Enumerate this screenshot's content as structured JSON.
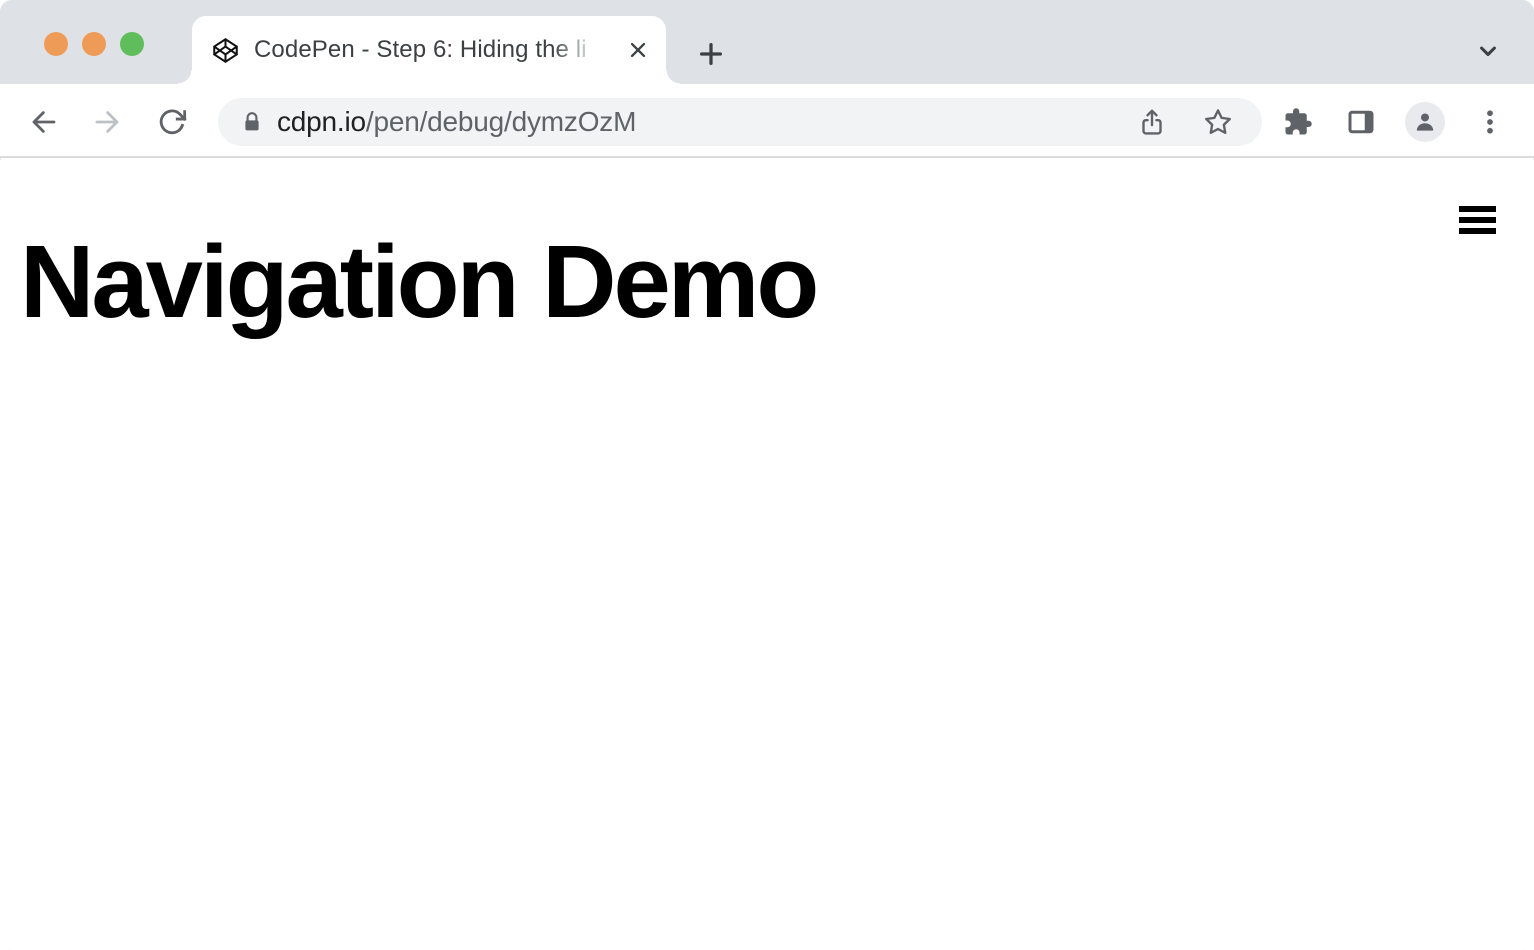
{
  "window": {
    "controls": [
      {
        "name": "close",
        "color": "#EE9B58"
      },
      {
        "name": "minimize",
        "color": "#EE9B58"
      },
      {
        "name": "maximize",
        "color": "#5FBD5B"
      }
    ]
  },
  "browser": {
    "tab": {
      "title": "CodePen - Step 6: Hiding the li"
    },
    "address_bar": {
      "domain": "cdpn.io",
      "path": "/pen/debug/dymzOzM"
    }
  },
  "page": {
    "heading": "Navigation Demo"
  },
  "icons": {
    "favicon": "codepen-logo",
    "tab_close": "x",
    "new_tab": "plus",
    "tab_strip_right": "chevron-down",
    "nav_left": [
      "arrow-left",
      "arrow-right-disabled",
      "reload"
    ],
    "omnibox": [
      "lock",
      "share",
      "bookmark-star"
    ],
    "toolbar_right": [
      "extensions-puzzle",
      "side-panel",
      "profile-avatar",
      "kebab-menu"
    ],
    "page": "hamburger-menu"
  },
  "colors": {
    "tab_strip_bg": "#DEE1E6",
    "surface": "#FFFFFF",
    "omnibox_bg": "#F1F3F4",
    "icon": "#5F6368",
    "icon_disabled": "#BDC1C6",
    "border": "#DADCE0",
    "tab_text": "#3C4043",
    "url_domain": "#202124",
    "url_path": "#5F6368",
    "heading_text": "#000000"
  }
}
